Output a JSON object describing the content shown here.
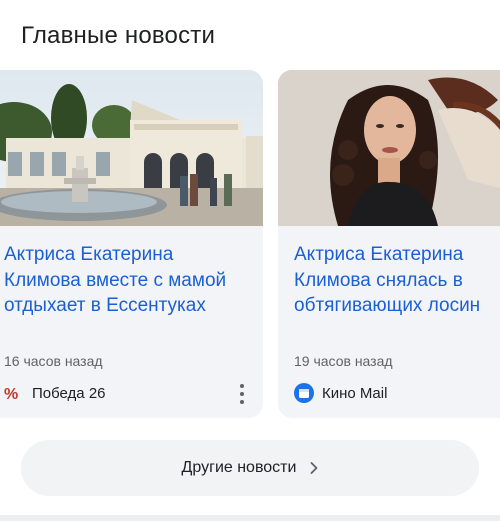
{
  "section": {
    "title": "Главные новости"
  },
  "cards": [
    {
      "headline_lines": [
        "Актриса Екатерина",
        "Климова вместе с мамой",
        "отдыхает в Ессентуках"
      ],
      "time": "16 часов назад",
      "source": "Победа 26",
      "source_icon": "pobeda26-logo-icon",
      "image": "resort-building-fountain-photo",
      "has_more_menu": true
    },
    {
      "headline_lines": [
        "Актриса Екатерина",
        "Климова снялась в",
        "обтягивающих лосин"
      ],
      "time": "19 часов назад",
      "source": "Кино Mail",
      "source_icon": "kino-mail-logo-icon",
      "image": "actress-portrait-photo",
      "has_more_menu": false
    }
  ],
  "more_button": {
    "label": "Другие новости",
    "icon": "chevron-right-icon"
  },
  "colors": {
    "headline": "#1a5fd4",
    "card_bg": "#f3f4f7",
    "button_bg": "#f1f3f4",
    "secondary_text": "#5f6368"
  }
}
